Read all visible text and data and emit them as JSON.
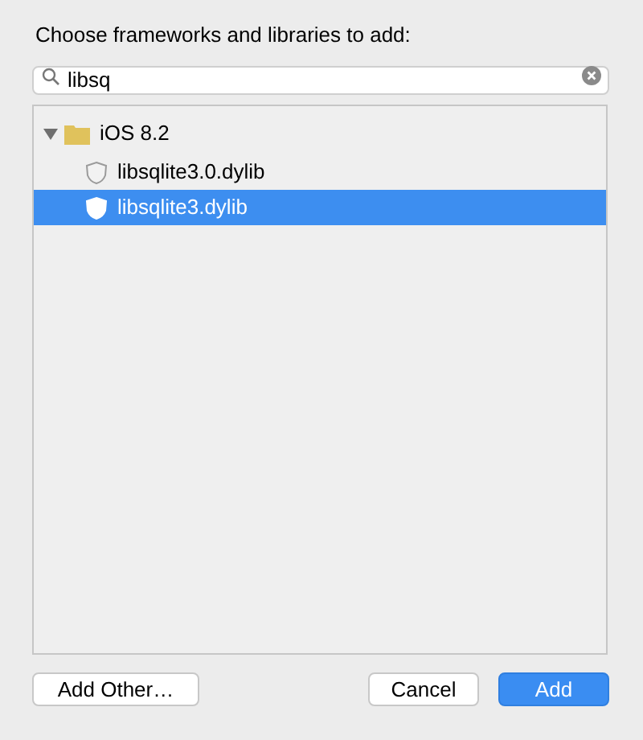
{
  "prompt": "Choose frameworks and libraries to add:",
  "search": {
    "value": "libsq"
  },
  "tree": [
    {
      "label": "iOS 8.2",
      "kind": "folder",
      "expanded": true,
      "selected": false,
      "children": [
        {
          "label": "libsqlite3.0.dylib",
          "kind": "library",
          "selected": false
        },
        {
          "label": "libsqlite3.dylib",
          "kind": "library",
          "selected": true
        }
      ]
    }
  ],
  "buttons": [
    {
      "label": "Add Other…",
      "default": false
    },
    {
      "label": "Cancel",
      "default": false
    },
    {
      "label": "Add",
      "default": true
    }
  ]
}
